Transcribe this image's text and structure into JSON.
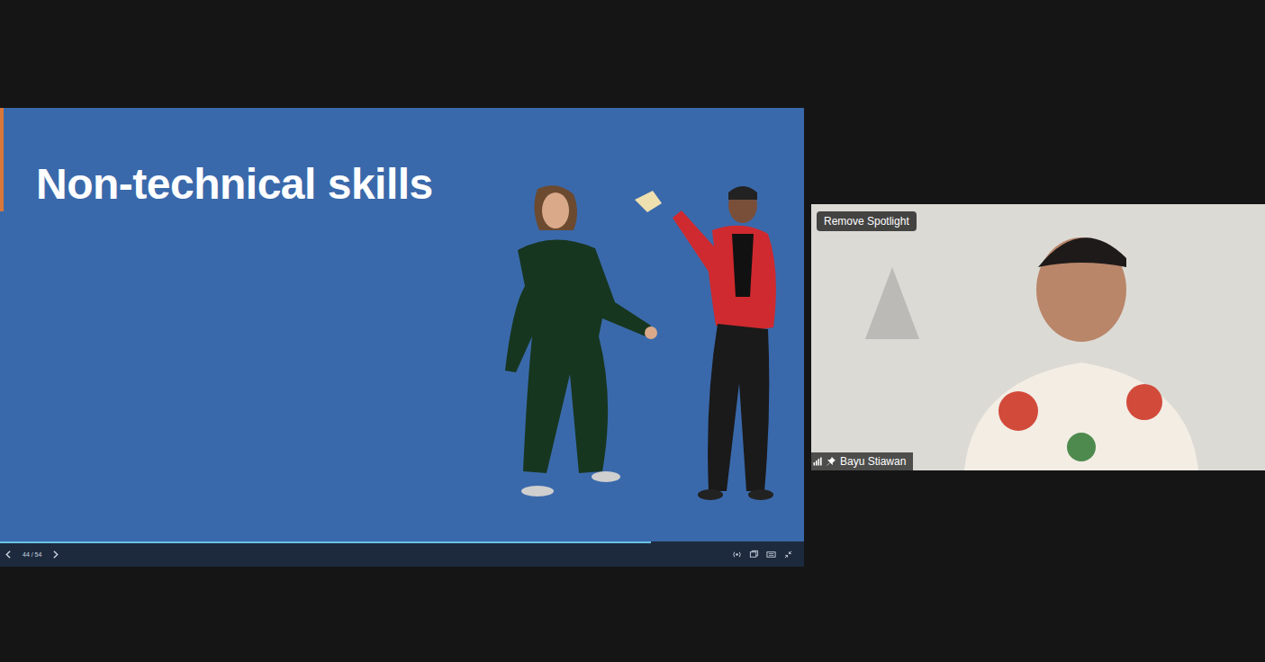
{
  "slide": {
    "title": "Non-technical skills",
    "page": "44 / 54",
    "progress": 0.81
  },
  "participant": {
    "name": "Bayu Stiawan",
    "spotlight_button": "Remove Spotlight",
    "pinned": true
  }
}
